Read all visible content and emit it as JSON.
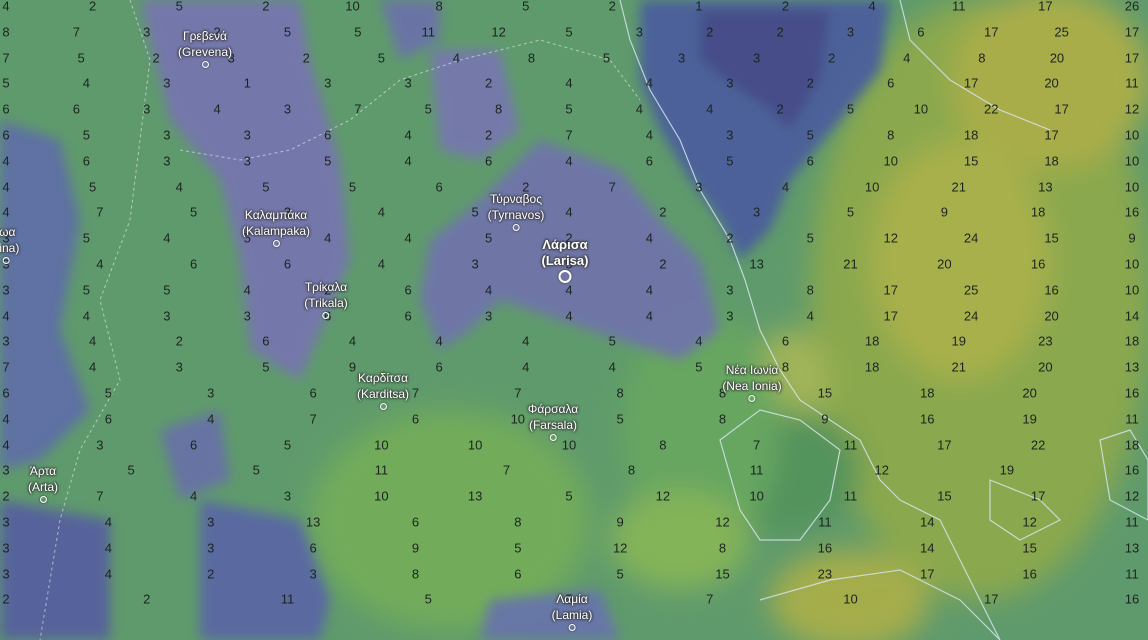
{
  "cities": [
    {
      "name": "Γρεβενά",
      "latin": "(Grevena)",
      "major": false
    },
    {
      "name": "Καλαμπάκα",
      "latin": "(Kalampaka)",
      "major": false
    },
    {
      "name": "Τρίκαλα",
      "latin": "(Trikala)",
      "major": false
    },
    {
      "name": "Καρδίτσα",
      "latin": "(Karditsa)",
      "major": false
    },
    {
      "name": "Τύρναβος",
      "latin": "(Tyrnavos)",
      "major": false
    },
    {
      "name": "Λάρισα",
      "latin": "(Larisa)",
      "major": true
    },
    {
      "name": "Φάρσαλα",
      "latin": "(Farsala)",
      "major": false
    },
    {
      "name": "Νέα Ιωνία",
      "latin": "(Nea Ionia)",
      "major": false
    },
    {
      "name": "Άρτα",
      "latin": "(Arta)",
      "major": false
    },
    {
      "name": "Λαμία",
      "latin": "(Lamia)",
      "major": false
    },
    {
      "name": "ιωα",
      "latin": "nina)",
      "major": false
    }
  ],
  "grid_values": [
    [
      "4",
      "2",
      "5",
      "2",
      "10",
      "8",
      "5",
      "2",
      "1",
      "2",
      "4",
      "11",
      "17",
      "26"
    ],
    [
      "8",
      "7",
      "3",
      "2",
      "5",
      "5",
      "11",
      "12",
      "5",
      "3",
      "2",
      "2",
      "3",
      "6",
      "17",
      "25",
      "17"
    ],
    [
      "7",
      "5",
      "2",
      "3",
      "2",
      "5",
      "4",
      "8",
      "5",
      "3",
      "3",
      "2",
      "4",
      "8",
      "20",
      "17"
    ],
    [
      "5",
      "4",
      "3",
      "1",
      "3",
      "3",
      "2",
      "4",
      "4",
      "3",
      "2",
      "6",
      "17",
      "20",
      "11"
    ],
    [
      "6",
      "6",
      "3",
      "4",
      "3",
      "7",
      "5",
      "8",
      "5",
      "4",
      "4",
      "2",
      "5",
      "10",
      "22",
      "17",
      "12"
    ],
    [
      "6",
      "5",
      "3",
      "3",
      "6",
      "4",
      "2",
      "7",
      "4",
      "3",
      "5",
      "8",
      "18",
      "17",
      "10"
    ],
    [
      "4",
      "6",
      "3",
      "3",
      "5",
      "4",
      "6",
      "4",
      "6",
      "5",
      "6",
      "10",
      "15",
      "18",
      "10"
    ],
    [
      "4",
      "5",
      "4",
      "5",
      "5",
      "6",
      "2",
      "7",
      "3",
      "4",
      "10",
      "21",
      "13",
      "10"
    ],
    [
      "4",
      "7",
      "5",
      "3",
      "4",
      "5",
      "4",
      "2",
      "3",
      "5",
      "9",
      "18",
      "16"
    ],
    [
      "3",
      "5",
      "4",
      "5",
      "4",
      "4",
      "5",
      "2",
      "4",
      "2",
      "5",
      "12",
      "24",
      "15",
      "9"
    ],
    [
      "3",
      "4",
      "6",
      "6",
      "4",
      "3",
      "5",
      "2",
      "13",
      "21",
      "20",
      "16",
      "10"
    ],
    [
      "3",
      "5",
      "5",
      "4",
      "2",
      "6",
      "4",
      "4",
      "4",
      "3",
      "8",
      "17",
      "25",
      "16",
      "10"
    ],
    [
      "4",
      "4",
      "3",
      "3",
      "6",
      "6",
      "3",
      "4",
      "4",
      "3",
      "4",
      "17",
      "24",
      "20",
      "14"
    ],
    [
      "3",
      "4",
      "2",
      "6",
      "4",
      "4",
      "4",
      "5",
      "4",
      "6",
      "18",
      "19",
      "23",
      "18"
    ],
    [
      "7",
      "4",
      "3",
      "5",
      "9",
      "6",
      "4",
      "4",
      "5",
      "8",
      "18",
      "21",
      "20",
      "13"
    ],
    [
      "6",
      "5",
      "3",
      "6",
      "7",
      "7",
      "8",
      "8",
      "15",
      "18",
      "20",
      "16"
    ],
    [
      "4",
      "6",
      "4",
      "7",
      "6",
      "10",
      "5",
      "8",
      "9",
      "16",
      "19",
      "11"
    ],
    [
      "4",
      "3",
      "6",
      "5",
      "10",
      "10",
      "10",
      "8",
      "7",
      "11",
      "17",
      "22",
      "18"
    ],
    [
      "3",
      "5",
      "5",
      "11",
      "7",
      "8",
      "11",
      "12",
      "19",
      "16"
    ],
    [
      "2",
      "7",
      "4",
      "3",
      "10",
      "13",
      "5",
      "12",
      "10",
      "11",
      "15",
      "17",
      "12"
    ],
    [
      "3",
      "4",
      "3",
      "13",
      "6",
      "8",
      "9",
      "12",
      "11",
      "14",
      "12",
      "11"
    ],
    [
      "3",
      "4",
      "3",
      "6",
      "9",
      "5",
      "12",
      "8",
      "16",
      "14",
      "15",
      "13"
    ],
    [
      "3",
      "4",
      "2",
      "3",
      "8",
      "6",
      "5",
      "15",
      "23",
      "17",
      "16",
      "11"
    ],
    [
      "2",
      "2",
      "11",
      "5",
      "5",
      "7",
      "10",
      "17",
      "16"
    ]
  ]
}
